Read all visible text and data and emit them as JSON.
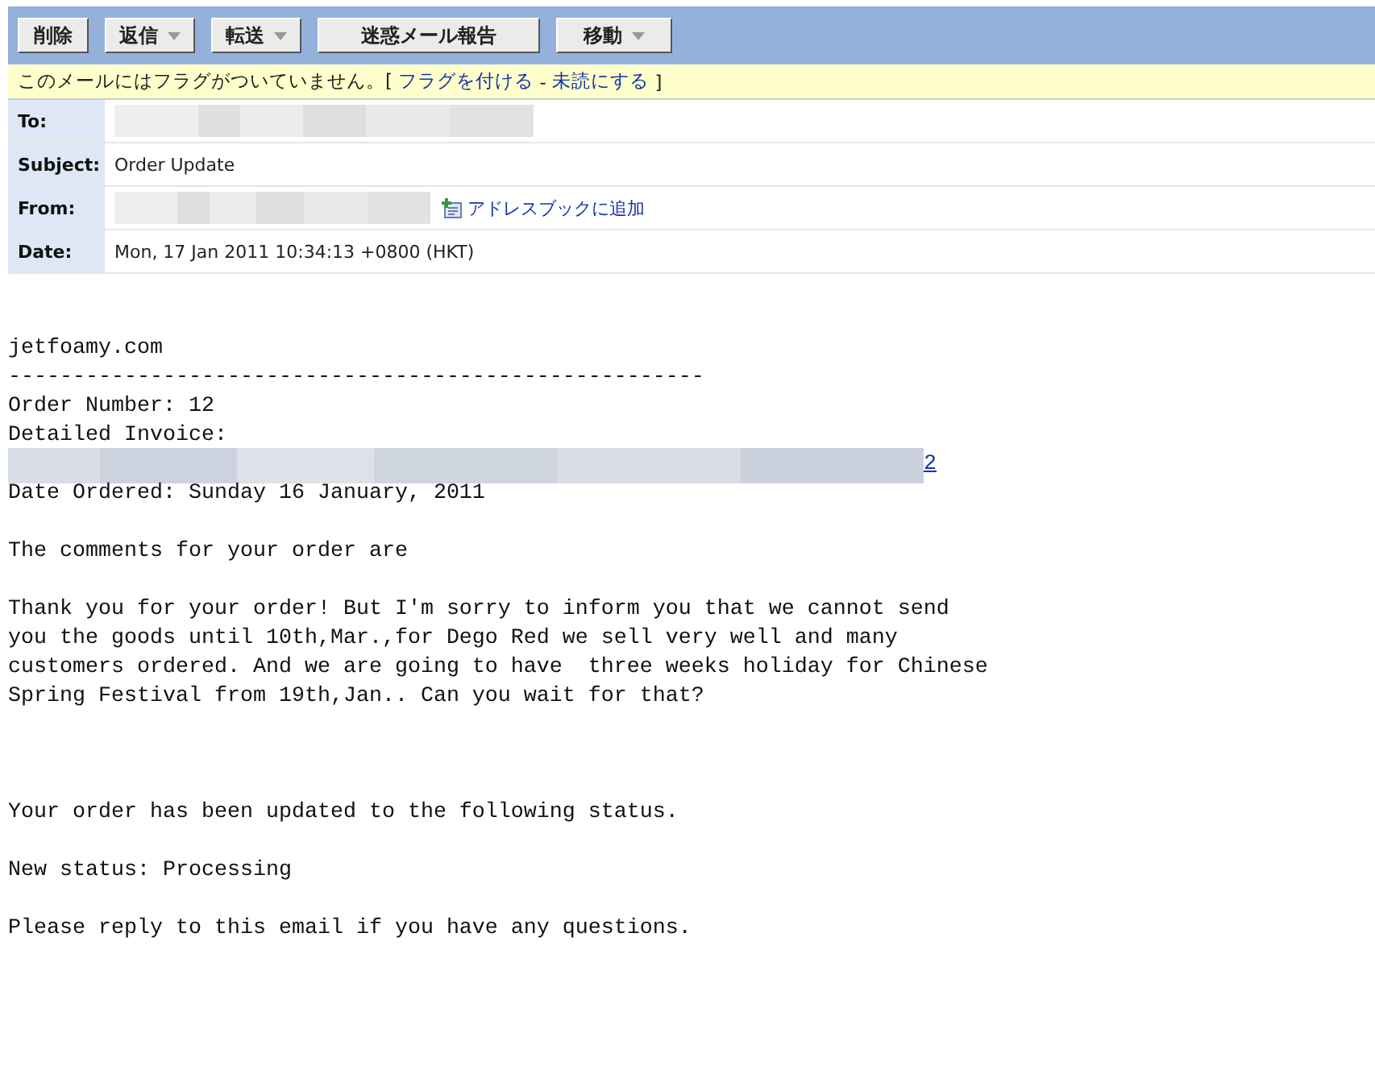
{
  "toolbar": [
    {
      "label": "削除",
      "dropdown": false
    },
    {
      "label": "返信",
      "dropdown": true
    },
    {
      "label": "転送",
      "dropdown": true
    },
    {
      "label": "迷惑メール報告",
      "dropdown": false
    },
    {
      "label": "移動",
      "dropdown": true
    }
  ],
  "flag_bar": {
    "text": "このメールにはフラグがついていません。[ ",
    "flag_link": "フラグを付ける",
    "separator": " - ",
    "unread_link": "未読にする",
    "close": " ]"
  },
  "headers": [
    {
      "label": "To:",
      "kind": "redacted"
    },
    {
      "label": "Subject:",
      "kind": "text",
      "value": "Order Update"
    },
    {
      "label": "From:",
      "kind": "redacted-address",
      "link": "アドレスブックに追加"
    },
    {
      "label": "Date:",
      "kind": "text",
      "value": "Mon, 17 Jan 2011 10:34:13 +0800 (HKT)"
    }
  ],
  "body": [
    {
      "kind": "text",
      "lines": [
        "jetfoamy.com",
        "------------------------------------------------------",
        "Order Number: 12",
        "Detailed Invoice:"
      ]
    },
    {
      "kind": "redacted-link",
      "link": "2"
    },
    {
      "kind": "text",
      "lines": [
        "Date Ordered: Sunday 16 January, 2011"
      ]
    },
    {
      "kind": "blank"
    },
    {
      "kind": "text",
      "lines": [
        "The comments for your order are"
      ]
    },
    {
      "kind": "blank"
    },
    {
      "kind": "text",
      "lines": [
        "Thank you for your order! But I'm sorry to inform you that we cannot send",
        "you the goods until 10th,Mar.,for Dego Red we sell very well and many",
        "customers ordered. And we are going to have  three weeks holiday for Chinese",
        "Spring Festival from 19th,Jan.. Can you wait for that?"
      ]
    },
    {
      "kind": "blank"
    },
    {
      "kind": "blank"
    },
    {
      "kind": "blank"
    },
    {
      "kind": "text",
      "lines": [
        "Your order has been updated to the following status."
      ]
    },
    {
      "kind": "blank"
    },
    {
      "kind": "text",
      "lines": [
        "New status: Processing"
      ]
    },
    {
      "kind": "blank"
    },
    {
      "kind": "text",
      "lines": [
        "Please reply to this email if you have any questions."
      ]
    }
  ]
}
